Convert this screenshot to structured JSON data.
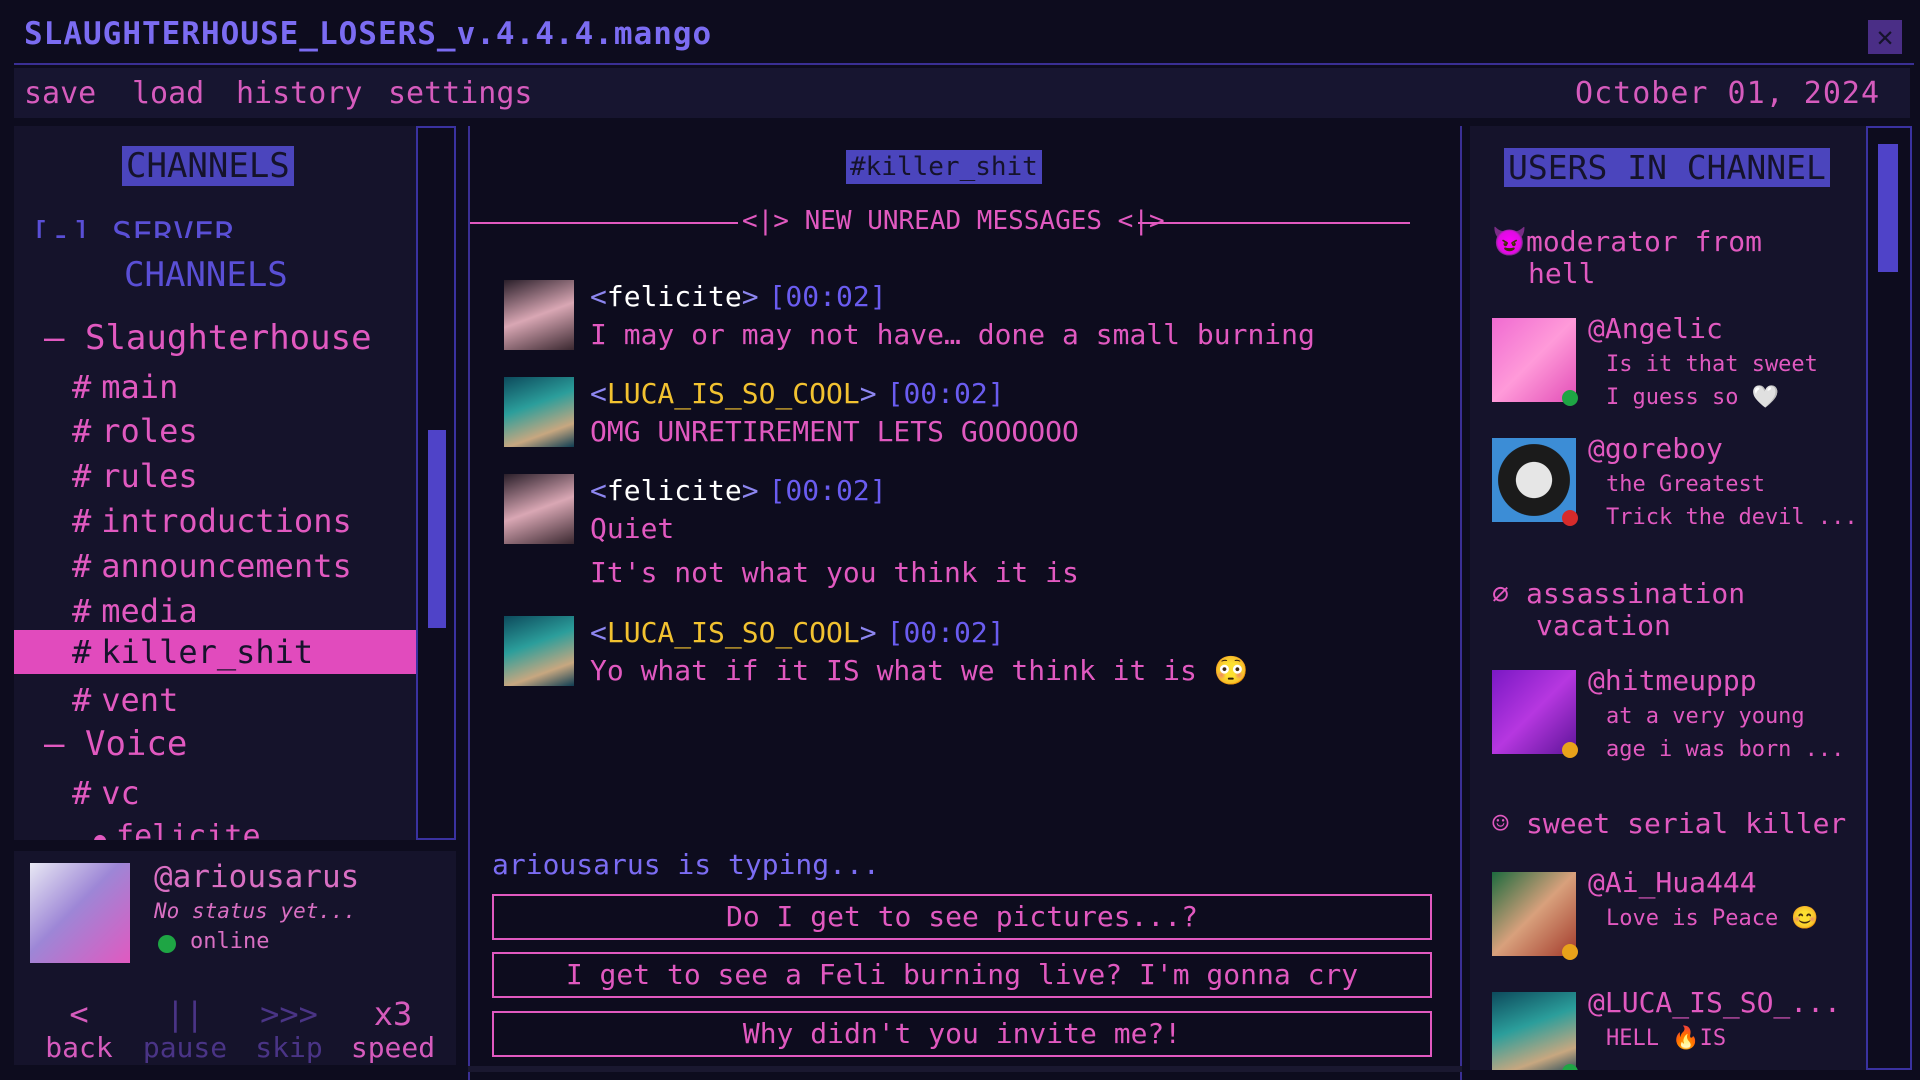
{
  "window": {
    "title": "SLAUGHTERHOUSE_LOSERS_v.4.4.4.mango"
  },
  "menu": {
    "items": [
      "save",
      "load",
      "history",
      "settings"
    ],
    "date": "October 01, 2024"
  },
  "channels": {
    "header": "CHANNELS",
    "server_label_1": "[-] SERVER",
    "server_label_2": "CHANNELS",
    "categories": [
      "Slaughterhouse",
      "Voice"
    ],
    "items": [
      "main",
      "roles",
      "rules",
      "introductions",
      "announcements",
      "media",
      "killer_shit",
      "vent"
    ],
    "voice_items": [
      "vc"
    ],
    "voice_user": "felicite",
    "active": "killer_shit",
    "cat_prefix": "–",
    "hash": "#"
  },
  "current_user": {
    "handle": "@ariousarus",
    "status": "No status yet...",
    "presence": "online"
  },
  "controls": [
    {
      "icon": "<",
      "label": "back"
    },
    {
      "icon": "||",
      "label": "pause"
    },
    {
      "icon": ">>>",
      "label": "skip"
    },
    {
      "icon": "x3",
      "label": "speed"
    }
  ],
  "chat": {
    "channel_title": "#killer_shit",
    "unread_banner": "<|> NEW UNREAD MESSAGES <|>",
    "messages": [
      {
        "nick": "felicite",
        "time": "[00:02]",
        "lines": [
          "I may or may not have… done a small burning"
        ]
      },
      {
        "nick": "LUCA_IS_SO_COOL",
        "time": "[00:02]",
        "lines": [
          "OMG UNRETIREMENT LETS GOOOOOO"
        ]
      },
      {
        "nick": "felicite",
        "time": "[00:02]",
        "lines": [
          "Quiet",
          "It's not what you think it is"
        ]
      },
      {
        "nick": "LUCA_IS_SO_COOL",
        "time": "[00:02]",
        "lines": [
          "Yo what if it IS what we think it is 😳"
        ]
      }
    ],
    "typing": "ariousarus is typing...",
    "choices": [
      "Do I get to see pictures...?",
      "I get to see a Feli burning live? I'm gonna cry",
      "Why didn't you invite me?!"
    ]
  },
  "users": {
    "header": "USERS IN CHANNEL",
    "groups": [
      {
        "icon": "😈",
        "label_1": "moderator from",
        "label_2": "hell"
      },
      {
        "icon": "∅",
        "label_1": "assassination",
        "label_2": "vacation"
      },
      {
        "icon": "☺",
        "label_1": "sweet serial killer"
      }
    ],
    "list": [
      {
        "handle": "@Angelic",
        "status_1": "Is it that sweet",
        "status_2": "I guess so 🤍",
        "presence_color": "#1ea544"
      },
      {
        "handle": "@goreboy",
        "status_1": "the Greatest",
        "status_2": "Trick the devil ...",
        "presence_color": "#d62b2b"
      },
      {
        "handle": "@hitmeuppp",
        "status_1": "at a very young",
        "status_2": "age i was born ...",
        "presence_color": "#e8a21a"
      },
      {
        "handle": "@Ai_Hua444",
        "status_1": "Love is Peace 😊",
        "presence_color": "#e8a21a"
      },
      {
        "handle": "@LUCA_IS_SO_...",
        "status_1": "HELL 🔥IS",
        "presence_color": "#1ea544"
      }
    ]
  },
  "colors": {
    "accent_pink": "#e159c0",
    "accent_blue": "#4b45bd",
    "background": "#0d0c1e"
  }
}
